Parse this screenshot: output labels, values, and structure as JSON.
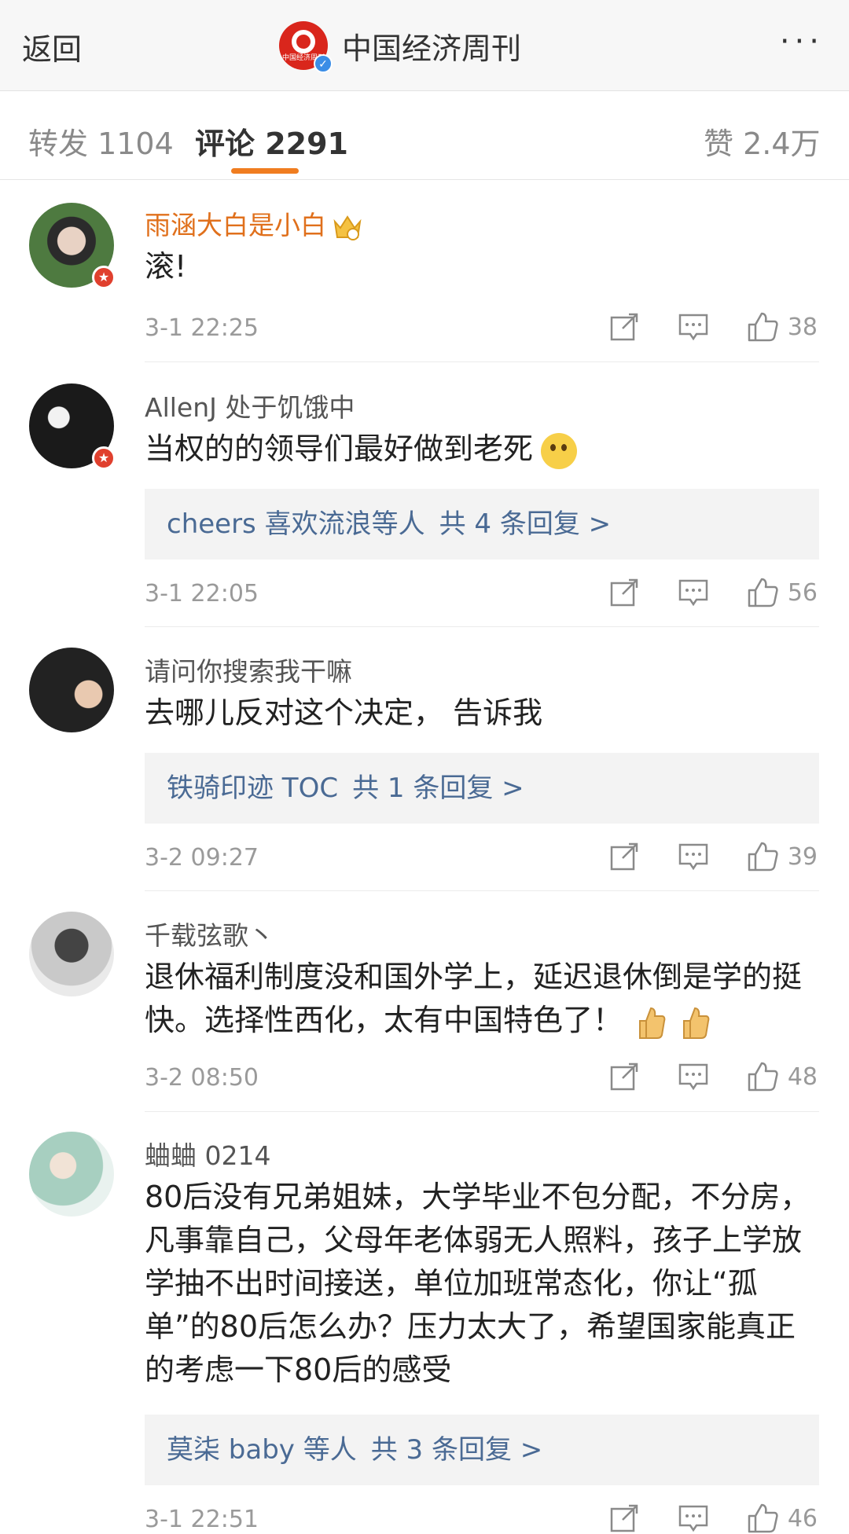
{
  "header": {
    "back_label": "返回",
    "title": "中国经济周刊",
    "logo_text": "中国经济周刊",
    "more_label": "···"
  },
  "tabs": {
    "repost": "转发 1104",
    "comments": "评论 2291",
    "likes": "赞 2.4万"
  },
  "colors": {
    "accent": "#f07d20",
    "link": "#4a6a94",
    "vip_name": "#e0701c"
  },
  "comments": [
    {
      "name": "雨涵大白是小白",
      "text": "滚!",
      "time": "3-1 22:25",
      "likes": "38",
      "replies": null
    },
    {
      "name": "AllenJ 处于饥饿中",
      "text": "当权的的领导们最好做到老死",
      "time": "3-1 22:05",
      "likes": "56",
      "replies": {
        "users": "cheers 喜欢流浪等人",
        "count": "共 4 条回复 >"
      }
    },
    {
      "name": "请问你搜索我干嘛",
      "text": "去哪儿反对这个决定， 告诉我",
      "time": "3-2 09:27",
      "likes": "39",
      "replies": {
        "users": "铁骑印迹 TOC",
        "count": "共 1 条回复 >"
      }
    },
    {
      "name": "千载弦歌丶",
      "text": "退休福利制度没和国外学上，延迟退休倒是学的挺快。选择性西化，太有中国特色了！",
      "time": "3-2 08:50",
      "likes": "48",
      "replies": null
    },
    {
      "name": "蛐蛐 0214",
      "text": "80后没有兄弟姐妹，大学毕业不包分配，不分房，凡事靠自己，父母年老体弱无人照料，孩子上学放学抽不出时间接送，单位加班常态化，你让“孤单”的80后怎么办？压力太大了，希望国家能真正的考虑一下80后的感受",
      "time": "3-1 22:51",
      "likes": "46",
      "replies": {
        "users": "莫柒 baby 等人",
        "count": "共 3 条回复 >"
      }
    }
  ]
}
